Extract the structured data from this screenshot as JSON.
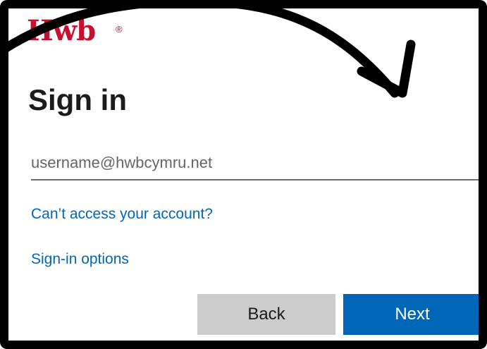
{
  "logo": {
    "text": "Hwb",
    "registered": "®"
  },
  "heading": "Sign in",
  "username": {
    "value": "",
    "placeholder": "username@hwbcymru.net"
  },
  "links": {
    "cant_access": "Can’t access your account?",
    "signin_options": "Sign-in options"
  },
  "buttons": {
    "back": "Back",
    "next": "Next"
  },
  "colors": {
    "brand": "#c8102e",
    "link": "#0067b8",
    "primary_button": "#0067b8",
    "secondary_button": "#cccccc"
  },
  "icons": {
    "annotation": "curved-arrow-icon"
  }
}
